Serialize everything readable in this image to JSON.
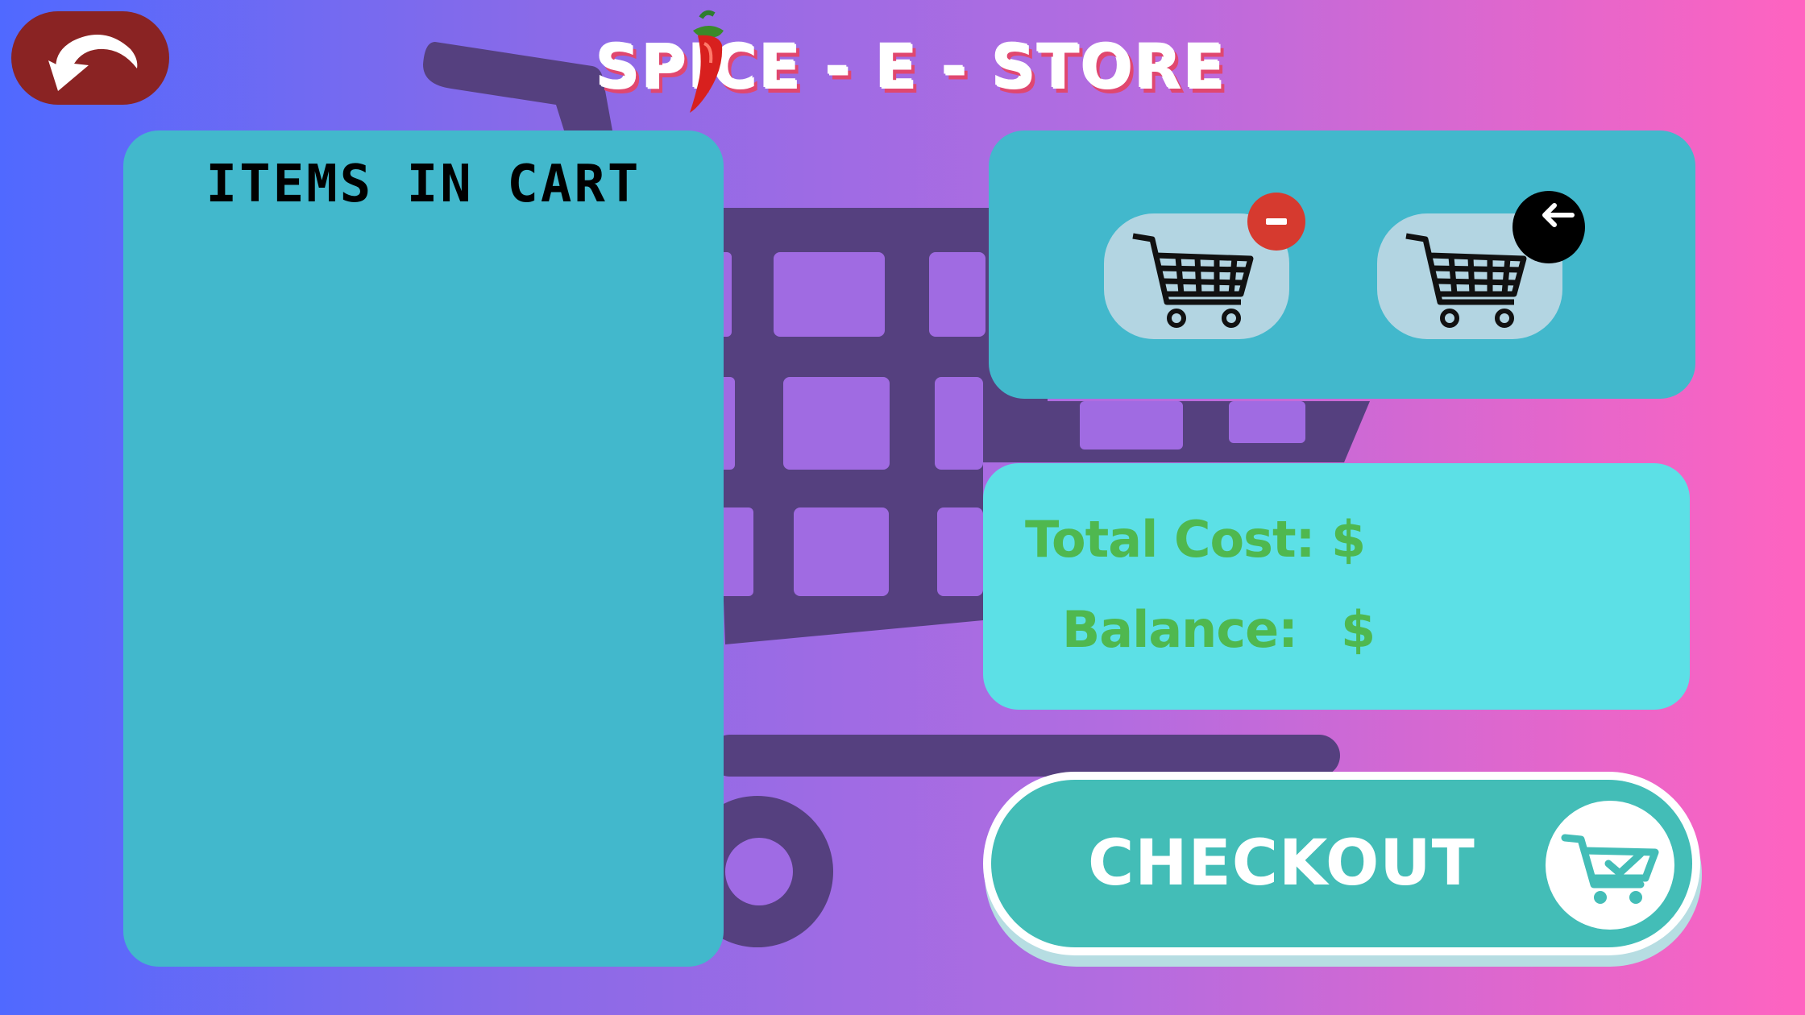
{
  "header": {
    "title": "SPICE - E - STORE",
    "back_icon": "back-arrow-icon",
    "chili_icon": "chili-pepper-icon"
  },
  "cart_panel": {
    "heading": "ITEMS IN CART",
    "items": []
  },
  "actions": {
    "remove_item_icon": "cart-minus-icon",
    "return_icon": "cart-back-arrow-icon"
  },
  "totals": {
    "total_cost_label": "Total Cost: $",
    "balance_label": "Balance:",
    "balance_currency": "$"
  },
  "checkout": {
    "label": "CHECKOUT",
    "icon": "cart-check-icon"
  },
  "colors": {
    "panel": "#42b8cc",
    "totals_panel": "#5ce0e6",
    "totals_text": "#4fb84f",
    "checkout": "#43bdb7",
    "back_button": "#8a2323",
    "remove_badge": "#d63a2f"
  }
}
